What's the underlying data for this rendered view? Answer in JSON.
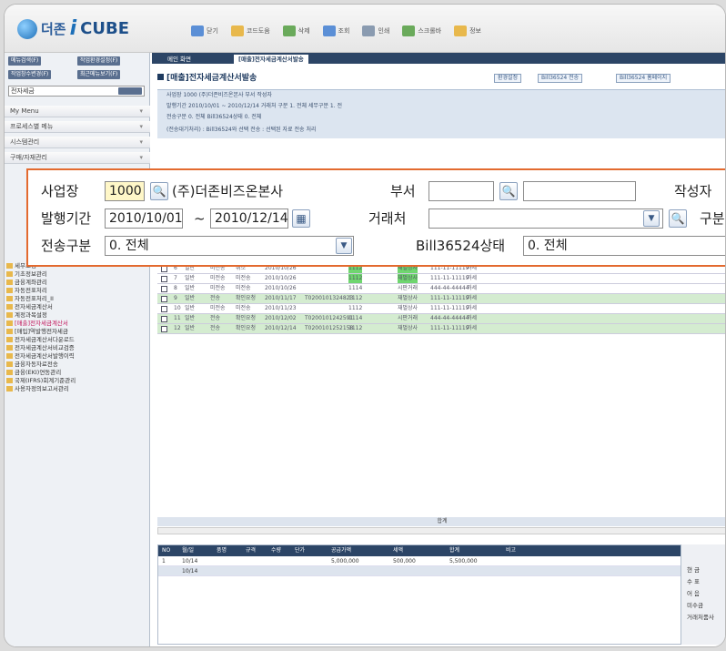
{
  "app": {
    "logo_prefix": "더존",
    "logo_i": "i",
    "logo_cube": "CUBE"
  },
  "toolbar": [
    {
      "label": "닫기",
      "icon": "close-icon",
      "color": "#5b8fd6"
    },
    {
      "label": "코드도움",
      "icon": "help-icon",
      "color": "#e8b84c"
    },
    {
      "label": "삭제",
      "icon": "delete-icon",
      "color": "#6aaa5b"
    },
    {
      "label": "조회",
      "icon": "search-icon",
      "color": "#5b8fd6"
    },
    {
      "label": "인쇄",
      "icon": "print-icon",
      "color": "#8a9bb0"
    },
    {
      "label": "스크롤바",
      "icon": "scroll-icon",
      "color": "#6aaa5b"
    },
    {
      "label": "정보",
      "icon": "info-icon",
      "color": "#e8b84c"
    }
  ],
  "sidebar": {
    "buttons": [
      "메뉴검색(F)",
      "작업환경설정(F)",
      "작업창수변경(F)",
      "최근메뉴보기(F)"
    ],
    "select_value": "전자세금",
    "menus": [
      {
        "label": "My Menu"
      },
      {
        "label": "프로세스별 메뉴"
      },
      {
        "label": "시스템관리"
      },
      {
        "label": "구매/자재관리"
      }
    ],
    "tree": [
      {
        "label": "세무조정",
        "sel": false
      },
      {
        "label": "기초정보관리",
        "sel": false
      },
      {
        "label": "금융계좌관리",
        "sel": false
      },
      {
        "label": "자동전표처리",
        "sel": false
      },
      {
        "label": "자동전표처리_II",
        "sel": false
      },
      {
        "label": "전자세금계산서",
        "sel": false
      },
      {
        "label": "계정과목설정",
        "sel": false
      },
      {
        "label": "[매출]전자세금계산서",
        "sel": true
      },
      {
        "label": "[매입]역발행전자세금",
        "sel": false
      },
      {
        "label": "전자세금계산서다운로드",
        "sel": false
      },
      {
        "label": "전자세금계산서비교검증",
        "sel": false
      },
      {
        "label": "전자세금계산서발행이력",
        "sel": false
      },
      {
        "label": "금융자동자료전송",
        "sel": false
      },
      {
        "label": "금융(EKI)연동관리",
        "sel": false
      },
      {
        "label": "국제(IFRS)회계기준관리",
        "sel": false
      },
      {
        "label": "사용자정의보고서관리",
        "sel": false
      }
    ]
  },
  "tabs": [
    {
      "label": "메인 화면",
      "active": false
    },
    {
      "label": "[매출]전자세금계산서발송",
      "active": true
    }
  ],
  "page": {
    "title": "[매출]전자세금계산서발송",
    "buttons": [
      "환경설정",
      "Bill36524 전송",
      "Bill36524 홈페이지"
    ]
  },
  "filter_small": {
    "row1": "사업장 1000 (주)더존비즈온본사   부서   작성자",
    "row2": "발행기간 2010/10/01 ~ 2010/12/14   거래처   구분 1. 전체   세무구분 1. 전",
    "row3": "전송구분 0. 전체   Bill36524상태 0. 전체",
    "row4": "(전송대기처리) : Bill36524와 선택 전송 : 선택된 자료 전송 처리"
  },
  "grid": {
    "rows": [
      [
        "4",
        "일반",
        "전송",
        "확인요청",
        "2010/10/25",
        "T0200101148848",
        "1112",
        "재벌상사",
        "111-11-11119",
        "과세"
      ],
      [
        "5",
        "일반",
        "전송",
        "확인",
        "2010/10/25",
        "T0200101275604",
        "1112",
        "재벌상사",
        "111-11-11119",
        "과세"
      ],
      [
        "6",
        "일반",
        "미전송",
        "취소",
        "2010/10/26",
        "",
        "1112",
        "재벌상사",
        "111-11-11119",
        "과세"
      ],
      [
        "7",
        "일반",
        "미전송",
        "미전송",
        "2010/10/26",
        "",
        "1112",
        "재벌상사",
        "111-11-11119",
        "과세"
      ],
      [
        "8",
        "일반",
        "미전송",
        "미전송",
        "2010/10/26",
        "",
        "1114",
        "시판거래",
        "444-44-44444",
        "과세"
      ],
      [
        "9",
        "일반",
        "전송",
        "확인요청",
        "2010/11/17",
        "T0200101324823",
        "1112",
        "재벌상사",
        "111-11-11119",
        "과세"
      ],
      [
        "10",
        "일반",
        "미전송",
        "미전송",
        "2010/11/23",
        "",
        "1112",
        "재벌상사",
        "111-11-11119",
        "과세"
      ],
      [
        "11",
        "일반",
        "전송",
        "확인요청",
        "2010/12/02",
        "T0200101242591",
        "1114",
        "시판거래",
        "444-44-44444",
        "과세"
      ],
      [
        "12",
        "일반",
        "전송",
        "확인요청",
        "2010/12/14",
        "T0200101252158",
        "1112",
        "재벌상사",
        "111-11-11119",
        "과세"
      ]
    ],
    "sum_label": "합계"
  },
  "detail": {
    "headers": [
      "NO",
      "월/일",
      "품명",
      "규격",
      "수량",
      "단가",
      "공급가액",
      "세액",
      "합계",
      "비고"
    ],
    "rows": [
      [
        "1",
        "10/14",
        "",
        "",
        "",
        "",
        "5,000,000",
        "500,000",
        "5,500,000",
        ""
      ],
      [
        "",
        "10/14",
        "",
        "",
        "",
        "",
        "",
        "",
        "",
        ""
      ]
    ],
    "right_labels": [
      "현 금",
      "수 표",
      "어 음",
      "미수금",
      "거래처품사"
    ]
  },
  "zoom": {
    "site_label": "사업장",
    "site_code": "1000",
    "site_name": "(주)더존비즈온본사",
    "dept_label": "부서",
    "author_label": "작성자",
    "period_label": "발행기간",
    "period_from": "2010/10/01",
    "period_tilde": "~",
    "period_to": "2010/12/14",
    "partner_label": "거래처",
    "type_label": "구분",
    "send_label": "전송구분",
    "send_value": "0. 전체",
    "bill_label": "Bill36524상태",
    "bill_value": "0. 전체"
  }
}
